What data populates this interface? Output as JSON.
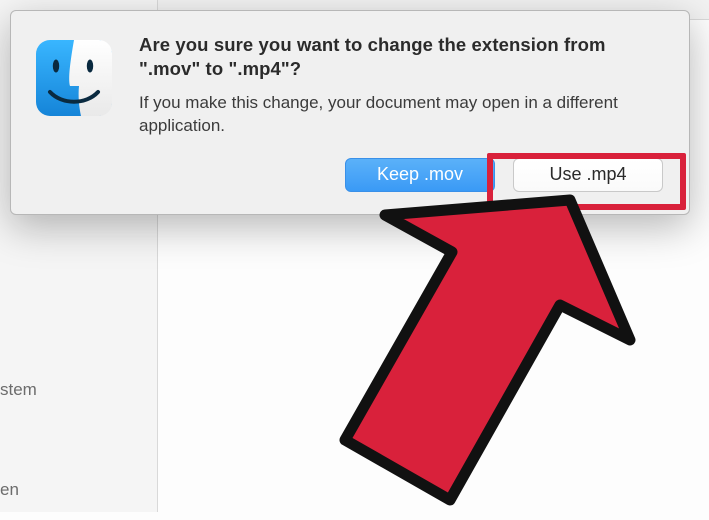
{
  "dialog": {
    "title": "Are you sure you want to change the extension from \".mov\" to \".mp4\"?",
    "description": "If you make this change, your document may open in a different application.",
    "keep_label": "Keep .mov",
    "use_label": "Use .mp4"
  },
  "sidebar": {
    "items": [
      {
        "label": ""
      },
      {
        "label": ""
      },
      {
        "label": "stem"
      },
      {
        "label": "en"
      }
    ]
  },
  "annotation": {
    "highlight_target": "use-button",
    "arrow_color": "#d9213b"
  }
}
